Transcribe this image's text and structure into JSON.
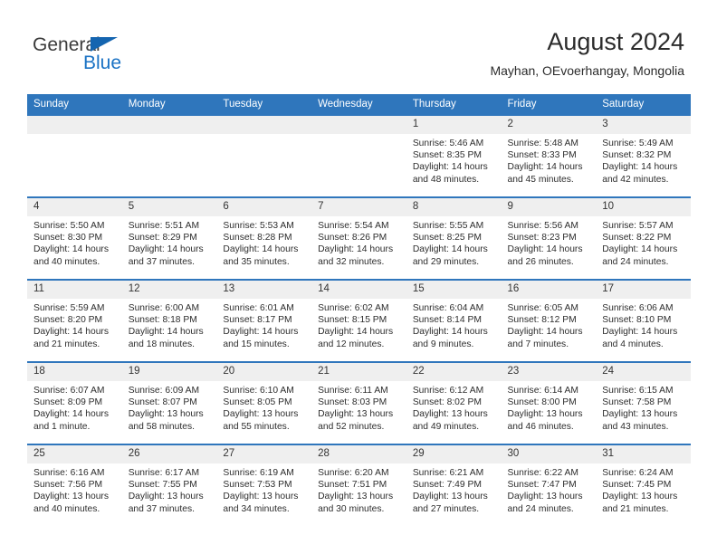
{
  "brand": {
    "line1": "General",
    "line2": "Blue",
    "triangle_color": "#1565b0",
    "blue_text_color": "#1a72c4"
  },
  "header": {
    "title": "August 2024",
    "subtitle": "Mayhan, OEvoerhangay, Mongolia"
  },
  "theme": {
    "header_blue": "#2f76bc",
    "daynum_gray": "#efefef",
    "text_color": "#2d2d2d"
  },
  "weekday_headers": [
    "Sunday",
    "Monday",
    "Tuesday",
    "Wednesday",
    "Thursday",
    "Friday",
    "Saturday"
  ],
  "weeks": [
    [
      {
        "day": "",
        "lines": []
      },
      {
        "day": "",
        "lines": []
      },
      {
        "day": "",
        "lines": []
      },
      {
        "day": "",
        "lines": []
      },
      {
        "day": "1",
        "lines": [
          "Sunrise: 5:46 AM",
          "Sunset: 8:35 PM",
          "Daylight: 14 hours",
          "and 48 minutes."
        ]
      },
      {
        "day": "2",
        "lines": [
          "Sunrise: 5:48 AM",
          "Sunset: 8:33 PM",
          "Daylight: 14 hours",
          "and 45 minutes."
        ]
      },
      {
        "day": "3",
        "lines": [
          "Sunrise: 5:49 AM",
          "Sunset: 8:32 PM",
          "Daylight: 14 hours",
          "and 42 minutes."
        ]
      }
    ],
    [
      {
        "day": "4",
        "lines": [
          "Sunrise: 5:50 AM",
          "Sunset: 8:30 PM",
          "Daylight: 14 hours",
          "and 40 minutes."
        ]
      },
      {
        "day": "5",
        "lines": [
          "Sunrise: 5:51 AM",
          "Sunset: 8:29 PM",
          "Daylight: 14 hours",
          "and 37 minutes."
        ]
      },
      {
        "day": "6",
        "lines": [
          "Sunrise: 5:53 AM",
          "Sunset: 8:28 PM",
          "Daylight: 14 hours",
          "and 35 minutes."
        ]
      },
      {
        "day": "7",
        "lines": [
          "Sunrise: 5:54 AM",
          "Sunset: 8:26 PM",
          "Daylight: 14 hours",
          "and 32 minutes."
        ]
      },
      {
        "day": "8",
        "lines": [
          "Sunrise: 5:55 AM",
          "Sunset: 8:25 PM",
          "Daylight: 14 hours",
          "and 29 minutes."
        ]
      },
      {
        "day": "9",
        "lines": [
          "Sunrise: 5:56 AM",
          "Sunset: 8:23 PM",
          "Daylight: 14 hours",
          "and 26 minutes."
        ]
      },
      {
        "day": "10",
        "lines": [
          "Sunrise: 5:57 AM",
          "Sunset: 8:22 PM",
          "Daylight: 14 hours",
          "and 24 minutes."
        ]
      }
    ],
    [
      {
        "day": "11",
        "lines": [
          "Sunrise: 5:59 AM",
          "Sunset: 8:20 PM",
          "Daylight: 14 hours",
          "and 21 minutes."
        ]
      },
      {
        "day": "12",
        "lines": [
          "Sunrise: 6:00 AM",
          "Sunset: 8:18 PM",
          "Daylight: 14 hours",
          "and 18 minutes."
        ]
      },
      {
        "day": "13",
        "lines": [
          "Sunrise: 6:01 AM",
          "Sunset: 8:17 PM",
          "Daylight: 14 hours",
          "and 15 minutes."
        ]
      },
      {
        "day": "14",
        "lines": [
          "Sunrise: 6:02 AM",
          "Sunset: 8:15 PM",
          "Daylight: 14 hours",
          "and 12 minutes."
        ]
      },
      {
        "day": "15",
        "lines": [
          "Sunrise: 6:04 AM",
          "Sunset: 8:14 PM",
          "Daylight: 14 hours",
          "and 9 minutes."
        ]
      },
      {
        "day": "16",
        "lines": [
          "Sunrise: 6:05 AM",
          "Sunset: 8:12 PM",
          "Daylight: 14 hours",
          "and 7 minutes."
        ]
      },
      {
        "day": "17",
        "lines": [
          "Sunrise: 6:06 AM",
          "Sunset: 8:10 PM",
          "Daylight: 14 hours",
          "and 4 minutes."
        ]
      }
    ],
    [
      {
        "day": "18",
        "lines": [
          "Sunrise: 6:07 AM",
          "Sunset: 8:09 PM",
          "Daylight: 14 hours",
          "and 1 minute."
        ]
      },
      {
        "day": "19",
        "lines": [
          "Sunrise: 6:09 AM",
          "Sunset: 8:07 PM",
          "Daylight: 13 hours",
          "and 58 minutes."
        ]
      },
      {
        "day": "20",
        "lines": [
          "Sunrise: 6:10 AM",
          "Sunset: 8:05 PM",
          "Daylight: 13 hours",
          "and 55 minutes."
        ]
      },
      {
        "day": "21",
        "lines": [
          "Sunrise: 6:11 AM",
          "Sunset: 8:03 PM",
          "Daylight: 13 hours",
          "and 52 minutes."
        ]
      },
      {
        "day": "22",
        "lines": [
          "Sunrise: 6:12 AM",
          "Sunset: 8:02 PM",
          "Daylight: 13 hours",
          "and 49 minutes."
        ]
      },
      {
        "day": "23",
        "lines": [
          "Sunrise: 6:14 AM",
          "Sunset: 8:00 PM",
          "Daylight: 13 hours",
          "and 46 minutes."
        ]
      },
      {
        "day": "24",
        "lines": [
          "Sunrise: 6:15 AM",
          "Sunset: 7:58 PM",
          "Daylight: 13 hours",
          "and 43 minutes."
        ]
      }
    ],
    [
      {
        "day": "25",
        "lines": [
          "Sunrise: 6:16 AM",
          "Sunset: 7:56 PM",
          "Daylight: 13 hours",
          "and 40 minutes."
        ]
      },
      {
        "day": "26",
        "lines": [
          "Sunrise: 6:17 AM",
          "Sunset: 7:55 PM",
          "Daylight: 13 hours",
          "and 37 minutes."
        ]
      },
      {
        "day": "27",
        "lines": [
          "Sunrise: 6:19 AM",
          "Sunset: 7:53 PM",
          "Daylight: 13 hours",
          "and 34 minutes."
        ]
      },
      {
        "day": "28",
        "lines": [
          "Sunrise: 6:20 AM",
          "Sunset: 7:51 PM",
          "Daylight: 13 hours",
          "and 30 minutes."
        ]
      },
      {
        "day": "29",
        "lines": [
          "Sunrise: 6:21 AM",
          "Sunset: 7:49 PM",
          "Daylight: 13 hours",
          "and 27 minutes."
        ]
      },
      {
        "day": "30",
        "lines": [
          "Sunrise: 6:22 AM",
          "Sunset: 7:47 PM",
          "Daylight: 13 hours",
          "and 24 minutes."
        ]
      },
      {
        "day": "31",
        "lines": [
          "Sunrise: 6:24 AM",
          "Sunset: 7:45 PM",
          "Daylight: 13 hours",
          "and 21 minutes."
        ]
      }
    ]
  ]
}
